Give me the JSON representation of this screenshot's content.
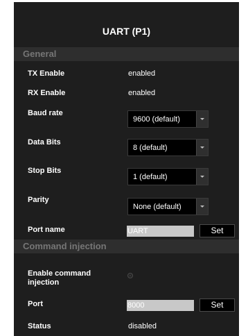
{
  "panel": {
    "title": "UART (P1)"
  },
  "general": {
    "header": "General",
    "tx_enable": {
      "label": "TX Enable",
      "value": "enabled"
    },
    "rx_enable": {
      "label": "RX Enable",
      "value": "enabled"
    },
    "baud_rate": {
      "label": "Baud rate",
      "selected": "9600 (default)"
    },
    "data_bits": {
      "label": "Data Bits",
      "selected": "8 (default)"
    },
    "stop_bits": {
      "label": "Stop Bits",
      "selected": "1 (default)"
    },
    "parity": {
      "label": "Parity",
      "selected": "None (default)"
    },
    "port_name": {
      "label": "Port name",
      "value": "UART",
      "button": "Set"
    }
  },
  "command_injection": {
    "header": "Command injection",
    "enable": {
      "label_line1": "Enable command",
      "label_line2": "injection",
      "checked": false
    },
    "port": {
      "label": "Port",
      "value": "8000",
      "button": "Set"
    },
    "status": {
      "label": "Status",
      "value": "disabled"
    }
  },
  "colors": {
    "panel_bg": "#1e1e1e",
    "section_header_bg": "#2e2e2e",
    "section_header_text": "#767676",
    "input_bg": "#c8c8c8",
    "select_bg": "#000000"
  },
  "icons": {
    "dropdown": "chevron-down-icon",
    "radio": "radio-icon"
  }
}
